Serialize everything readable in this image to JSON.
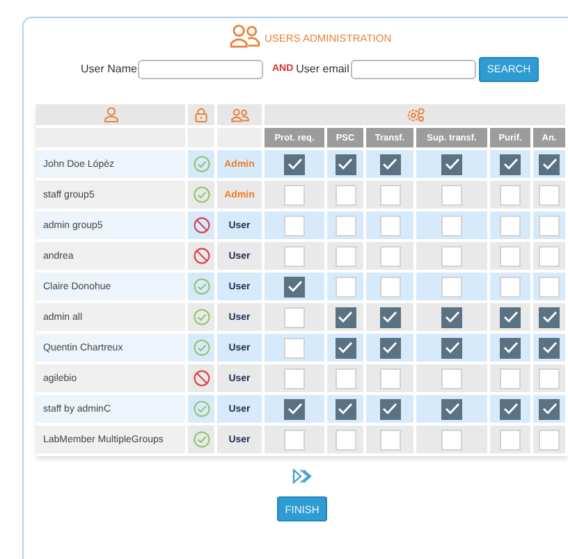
{
  "title": "USERS ADMINISTRATION",
  "search": {
    "name_label": "User Name",
    "operator": "AND",
    "email_label": "User email",
    "button": "SEARCH"
  },
  "table": {
    "columns": [
      "Prot. req.",
      "PSC",
      "Transf.",
      "Sup. transf.",
      "Purif.",
      "An."
    ],
    "rows": [
      {
        "name": "John Doe Lópèz",
        "active": true,
        "role": "Admin",
        "kind": "admin",
        "rights": [
          true,
          true,
          true,
          true,
          true,
          true
        ]
      },
      {
        "name": "staff group5",
        "active": true,
        "role": "Admin",
        "kind": "admin",
        "rights": [
          false,
          false,
          false,
          false,
          false,
          false
        ]
      },
      {
        "name": "admin group5",
        "active": false,
        "role": "User",
        "kind": "user",
        "rights": [
          false,
          false,
          false,
          false,
          false,
          false
        ]
      },
      {
        "name": "andrea",
        "active": false,
        "role": "User",
        "kind": "user",
        "rights": [
          false,
          false,
          false,
          false,
          false,
          false
        ]
      },
      {
        "name": "Claire Donohue",
        "active": true,
        "role": "User",
        "kind": "user",
        "rights": [
          true,
          false,
          false,
          false,
          false,
          false
        ]
      },
      {
        "name": "admin all",
        "active": true,
        "role": "User",
        "kind": "user",
        "rights": [
          false,
          true,
          true,
          true,
          true,
          true
        ]
      },
      {
        "name": "Quentin Chartreux",
        "active": true,
        "role": "User",
        "kind": "user",
        "rights": [
          false,
          true,
          true,
          true,
          true,
          true
        ]
      },
      {
        "name": "agilebio",
        "active": false,
        "role": "User",
        "kind": "user",
        "rights": [
          false,
          false,
          false,
          false,
          false,
          false
        ]
      },
      {
        "name": "staff by adminC",
        "active": true,
        "role": "User",
        "kind": "user",
        "rights": [
          true,
          true,
          true,
          true,
          true,
          true
        ]
      },
      {
        "name": "LabMember MultipleGroups",
        "active": true,
        "role": "User",
        "kind": "user",
        "rights": [
          false,
          false,
          false,
          false,
          false,
          false
        ]
      }
    ]
  },
  "finish_button": "FINISH"
}
